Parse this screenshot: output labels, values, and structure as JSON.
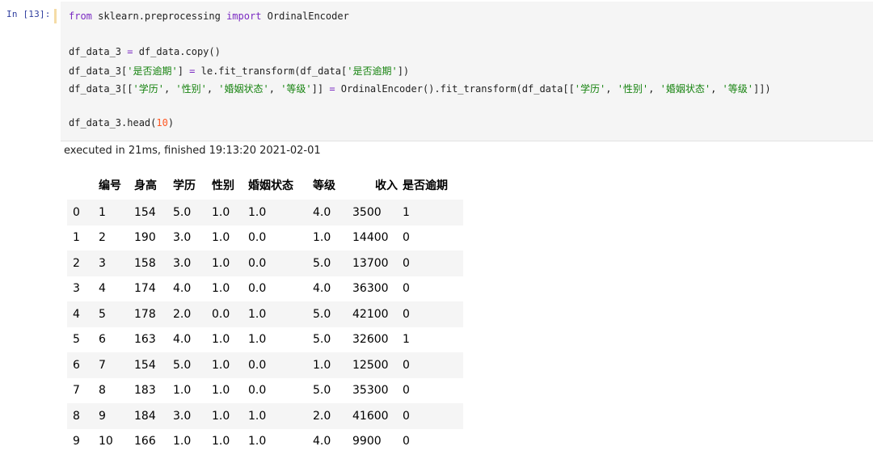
{
  "cell": {
    "prompt": "In [13]:",
    "code": {
      "line1": {
        "from": "from",
        "module": " sklearn.preprocessing ",
        "import": "import",
        "name": " OrdinalEncoder"
      },
      "line2": {
        "a": "df_data_3 ",
        "eq": "=",
        "b": " df_data.copy()"
      },
      "line3": {
        "a": "df_data_3[",
        "s1": "'是否逾期'",
        "b": "] ",
        "eq": "=",
        "c": " le.fit_transform(df_data[",
        "s2": "'是否逾期'",
        "d": "])"
      },
      "line4": {
        "a": "df_data_3[[",
        "s1": "'学历'",
        "c1": ", ",
        "s2": "'性别'",
        "c2": ", ",
        "s3": "'婚姻状态'",
        "c3": ", ",
        "s4": "'等级'",
        "b": "]] ",
        "eq": "=",
        "c": " OrdinalEncoder().fit_transform(df_data[[",
        "t1": "'学历'",
        "d1": ", ",
        "t2": "'性别'",
        "d2": ", ",
        "t3": "'婚姻状态'",
        "d3": ", ",
        "t4": "'等级'",
        "e": "]])"
      },
      "line5": {
        "a": "df_data_3.head(",
        "num": "10",
        "b": ")"
      }
    },
    "executed": "executed in 21ms, finished 19:13:20 2021-02-01"
  },
  "table": {
    "columns": [
      "编号",
      "身高",
      "学历",
      "性别",
      "婚姻状态",
      "等级",
      "收入",
      "是否逾期"
    ],
    "rows": [
      [
        "0",
        "1",
        "154",
        "5.0",
        "1.0",
        "1.0",
        "4.0",
        "3500",
        "1"
      ],
      [
        "1",
        "2",
        "190",
        "3.0",
        "1.0",
        "0.0",
        "1.0",
        "14400",
        "0"
      ],
      [
        "2",
        "3",
        "158",
        "3.0",
        "1.0",
        "0.0",
        "5.0",
        "13700",
        "0"
      ],
      [
        "3",
        "4",
        "174",
        "4.0",
        "1.0",
        "0.0",
        "4.0",
        "36300",
        "0"
      ],
      [
        "4",
        "5",
        "178",
        "2.0",
        "0.0",
        "1.0",
        "5.0",
        "42100",
        "0"
      ],
      [
        "5",
        "6",
        "163",
        "4.0",
        "1.0",
        "1.0",
        "5.0",
        "32600",
        "1"
      ],
      [
        "6",
        "7",
        "154",
        "5.0",
        "1.0",
        "0.0",
        "1.0",
        "12500",
        "0"
      ],
      [
        "7",
        "8",
        "183",
        "1.0",
        "1.0",
        "0.0",
        "5.0",
        "35300",
        "0"
      ],
      [
        "8",
        "9",
        "184",
        "3.0",
        "1.0",
        "1.0",
        "2.0",
        "41600",
        "0"
      ],
      [
        "9",
        "10",
        "166",
        "1.0",
        "1.0",
        "1.0",
        "4.0",
        "9900",
        "0"
      ]
    ]
  }
}
